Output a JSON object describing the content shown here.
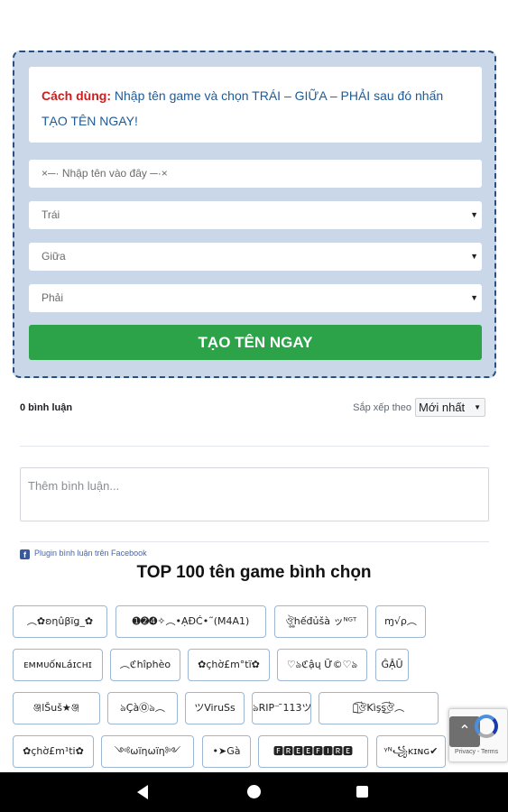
{
  "generator": {
    "howto_label": "Cách dùng:",
    "howto_text": " Nhập tên game và chọn TRÁI – GIỮA – PHẢI sau đó nhấn TẠO TÊN NGAY!",
    "name_placeholder": "×─· Nhập tên vào đây ─·×",
    "left_select": "Trái",
    "middle_select": "Giữa",
    "right_select": "Phải",
    "button": "TẠO TÊN NGAY",
    "colors": {
      "panel_bg": "#c9d7e8",
      "panel_border": "#2c4f82",
      "button": "#2ca348",
      "label_red": "#d01c1c",
      "text_blue": "#1f5a96"
    }
  },
  "comments": {
    "count": "0 bình luận",
    "sort_label": "Sắp xếp theo",
    "sort_value": "Mới nhất",
    "add_placeholder": "Thêm bình luận...",
    "plugin_text": "Plugin bình luận trên Facebook"
  },
  "top": {
    "title": "TOP 100 tên game bình chọn",
    "names": [
      "︵✿ʚηûβïǥ_✿",
      "➊➋➍✧︵•ẠĐĆ•˜(M4A1)",
      "ঔৣhếđủšà ッᴺᴳᵀ",
      "ɱ√ρ︵",
      "ᴇᴍᴍᴜốɴʟáɪᴄʜɪ",
      "︵ℭhîphèo",
      "✿çhờ£m°tï✿",
      "♡ঌℭậų Ữ©♡ঌ",
      "ĜẬŨ",
      "ঞ্জlŠuš★ঞ্জ",
      "ঌÇàⓄঌ︵",
      "ツViruSs",
      "ঌRIP⁻ ̄113ツ",
      "ঌ͜͡ঔKìşş͜͡ঔ︵",
      "✿çhờ£m¹ti✿",
      "༺ωïηωïη༻",
      "•➤Gà",
      "🅵🆁🅴🅴🅵🅸🆁🅴",
      "ᵞᴺ꧁ᴋɪɴɢ✔"
    ]
  },
  "recaptcha": {
    "text": "Privacy - Terms"
  },
  "navbar": {
    "back": "back",
    "home": "home",
    "recent": "recent-apps"
  }
}
